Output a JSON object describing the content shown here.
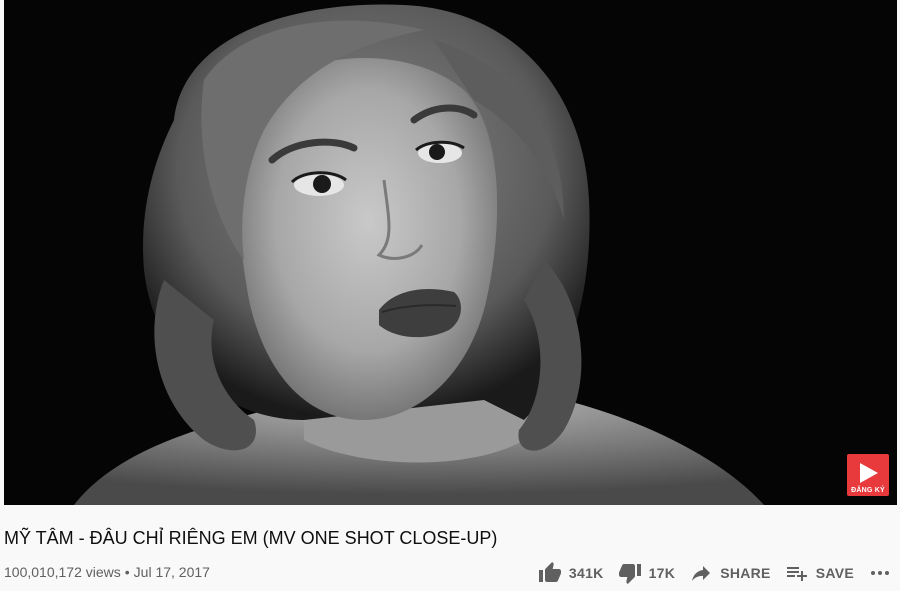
{
  "video": {
    "title": "MỸ TÂM - ĐÂU CHỈ RIÊNG EM (MV ONE SHOT CLOSE-UP)",
    "views": "100,010,172 views",
    "separator": "•",
    "date": "Jul 17, 2017",
    "watermark_label": "ĐĂNG KÝ",
    "watermark_color": "#e8393c"
  },
  "actions": {
    "like_count": "341K",
    "dislike_count": "17K",
    "share_label": "SHARE",
    "save_label": "SAVE",
    "icons": [
      "thumb-up-icon",
      "thumb-down-icon",
      "share-arrow-icon",
      "playlist-add-icon",
      "more-horizontal-icon"
    ]
  },
  "theme": {
    "background": "#f9f9f9",
    "text_primary": "#0f0f0f",
    "text_secondary": "#606060"
  }
}
